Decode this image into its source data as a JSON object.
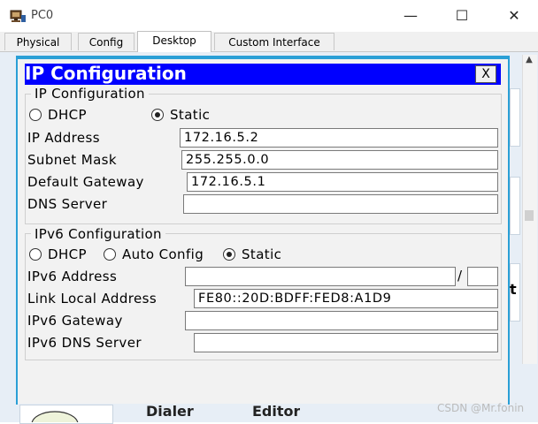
{
  "window": {
    "title": "PC0",
    "app_icon": "packet-tracer-pc-icon",
    "controls": {
      "minimize": "—",
      "maximize": "☐",
      "close": "✕"
    }
  },
  "tabs": [
    {
      "label": "Physical"
    },
    {
      "label": "Config"
    },
    {
      "label": "Desktop"
    },
    {
      "label": "Custom Interface"
    }
  ],
  "active_tab": "Desktop",
  "dialog": {
    "title": "IP Configuration",
    "close_label": "X",
    "ipv4": {
      "legend": "IP Configuration",
      "dhcp_label": "DHCP",
      "static_label": "Static",
      "mode": "Static",
      "ip_label": "IP Address",
      "ip_value": "172.16.5.2",
      "mask_label": "Subnet Mask",
      "mask_value": "255.255.0.0",
      "gateway_label": "Default Gateway",
      "gateway_value": "172.16.5.1",
      "dns_label": "DNS Server",
      "dns_value": ""
    },
    "ipv6": {
      "legend": "IPv6 Configuration",
      "dhcp_label": "DHCP",
      "auto_label": "Auto Config",
      "static_label": "Static",
      "mode": "Static",
      "address_label": "IPv6 Address",
      "address_value": "",
      "prefix_sep": "/",
      "prefix_value": "",
      "link_local_label": "Link Local Address",
      "link_local_value": "FE80::20D:BDFF:FED8:A1D9",
      "gateway_label": "IPv6 Gateway",
      "gateway_value": "",
      "dns_label": "IPv6 DNS Server",
      "dns_value": ""
    }
  },
  "background": {
    "bottom_left": "Dialer",
    "bottom_mid": "Editor"
  },
  "watermark": "CSDN @Mr.fonin",
  "colors": {
    "dialog_title_bg": "#0000ff",
    "desktop_blue": "#2a9fd6"
  }
}
